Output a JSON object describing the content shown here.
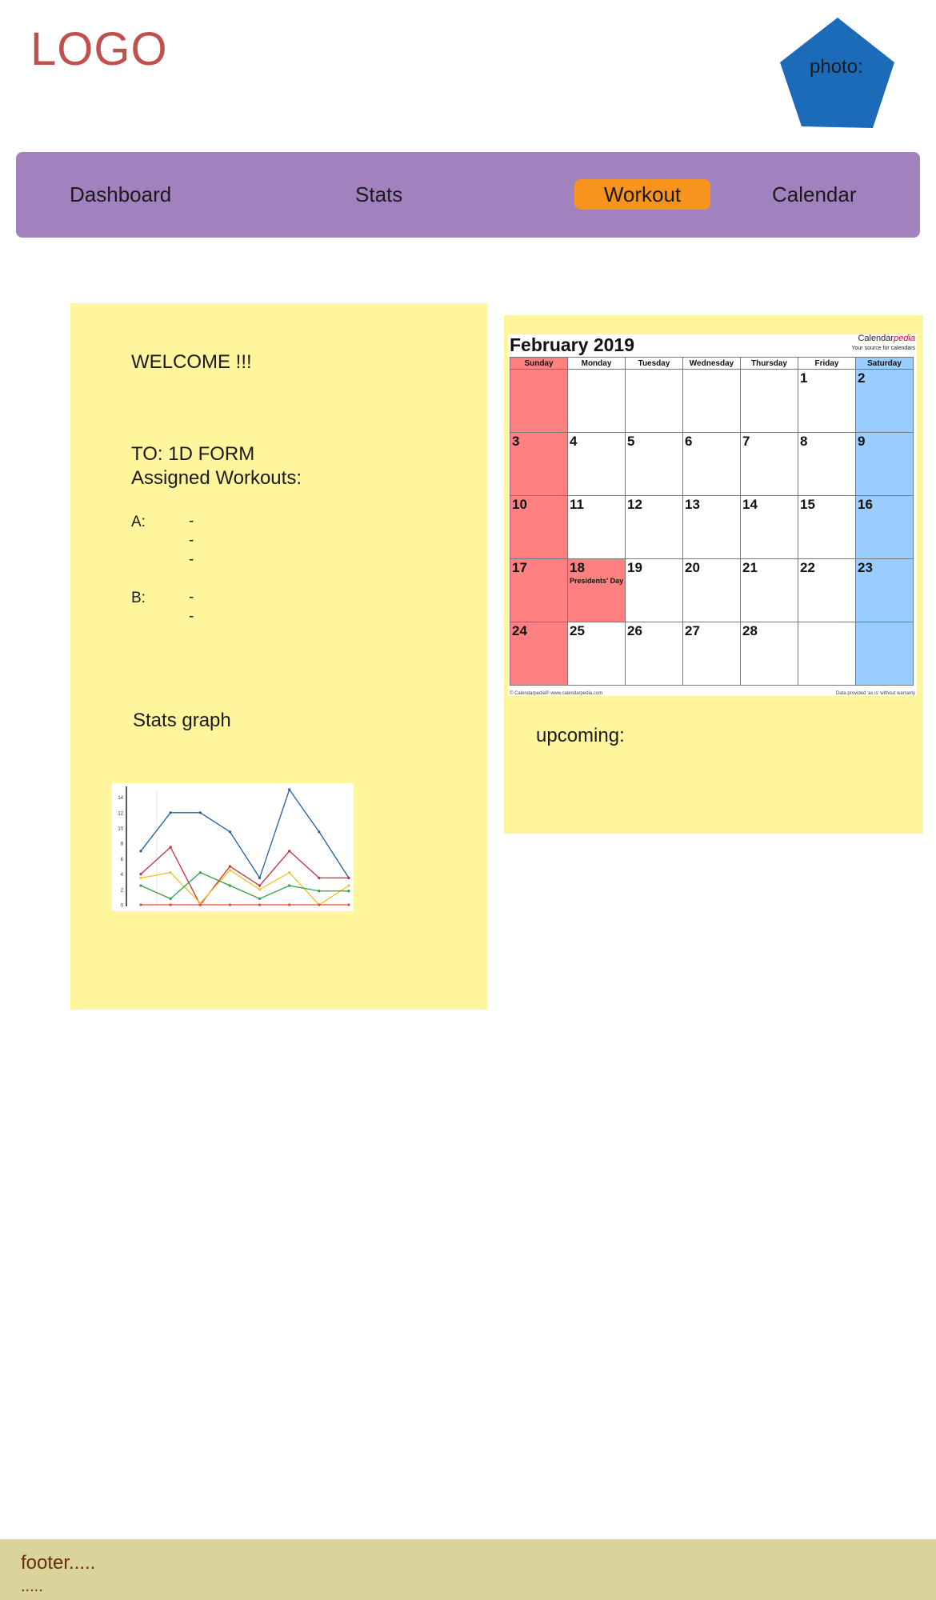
{
  "header": {
    "logo": "LOGO",
    "photo_label": "photo:"
  },
  "nav": {
    "items": [
      {
        "label": "Dashboard"
      },
      {
        "label": "Stats"
      },
      {
        "label": "Workout",
        "active": true
      },
      {
        "label": "Calendar"
      }
    ]
  },
  "welcome": {
    "greeting": "WELCOME   !!!",
    "to_line": "TO: 1D  FORM",
    "assigned": "Assigned Workouts:",
    "group_a_label": "A:",
    "group_a_items": [
      "-",
      "-",
      "-"
    ],
    "group_b_label": "B:",
    "group_b_items": [
      "-",
      "-"
    ],
    "stats_graph_label": "Stats graph"
  },
  "chart_data": {
    "type": "line",
    "x": [
      1,
      2,
      3,
      4,
      5,
      6,
      7,
      8
    ],
    "ylim": [
      0,
      15
    ],
    "yticks": [
      "0",
      "2",
      "4",
      "6",
      "8",
      "10",
      "12",
      "14"
    ],
    "series": [
      {
        "color": "#1f5fa0",
        "values": [
          7,
          12,
          12,
          9.5,
          3.5,
          15,
          9.5,
          3.5
        ]
      },
      {
        "color": "#c0303a",
        "values": [
          4,
          7.5,
          0,
          5,
          2.5,
          7,
          3.5,
          3.5
        ]
      },
      {
        "color": "#f0c020",
        "values": [
          3.5,
          4.2,
          0.2,
          4.5,
          2,
          4.2,
          0,
          2.5
        ]
      },
      {
        "color": "#30a040",
        "values": [
          2.5,
          0.8,
          4.2,
          2.5,
          0.8,
          2.5,
          1.8,
          1.8
        ]
      },
      {
        "color": "#e05030",
        "values": [
          0,
          0,
          0,
          0,
          0,
          0,
          0,
          0
        ]
      }
    ]
  },
  "calendar": {
    "title": "February 2019",
    "brand": "Calendar",
    "brand_accent": "pedia",
    "brand_sub": "Your source for calendars",
    "weekdays": [
      "Sunday",
      "Monday",
      "Tuesday",
      "Wednesday",
      "Thursday",
      "Friday",
      "Saturday"
    ],
    "weeks": [
      [
        "",
        "",
        "",
        "",
        "",
        "1",
        "2"
      ],
      [
        "3",
        "4",
        "5",
        "6",
        "7",
        "8",
        "9"
      ],
      [
        "10",
        "11",
        "12",
        "13",
        "14",
        "15",
        "16"
      ],
      [
        "17",
        "18",
        "19",
        "20",
        "21",
        "22",
        "23"
      ],
      [
        "24",
        "25",
        "26",
        "27",
        "28",
        "",
        ""
      ]
    ],
    "holiday": {
      "day": "18",
      "label": "Presidents' Day"
    },
    "footer_left": "© Calendarpedia®   www.calendarpedia.com",
    "footer_right": "Data provided 'as is' without warranty",
    "colors": {
      "weekend_sun": "#ff8080",
      "weekend_sat": "#99ccff"
    }
  },
  "upcoming": {
    "label": "upcoming:"
  },
  "footer": {
    "line1": "footer.....",
    "line2": "....."
  },
  "colors": {
    "logo": "#c0504d",
    "photo": "#1c6bb8",
    "nav_bg": "#a282be",
    "nav_active": "#f7941d",
    "panel": "#fff59d",
    "footer_bg": "#dad39a",
    "footer_text": "#6b2a12"
  }
}
